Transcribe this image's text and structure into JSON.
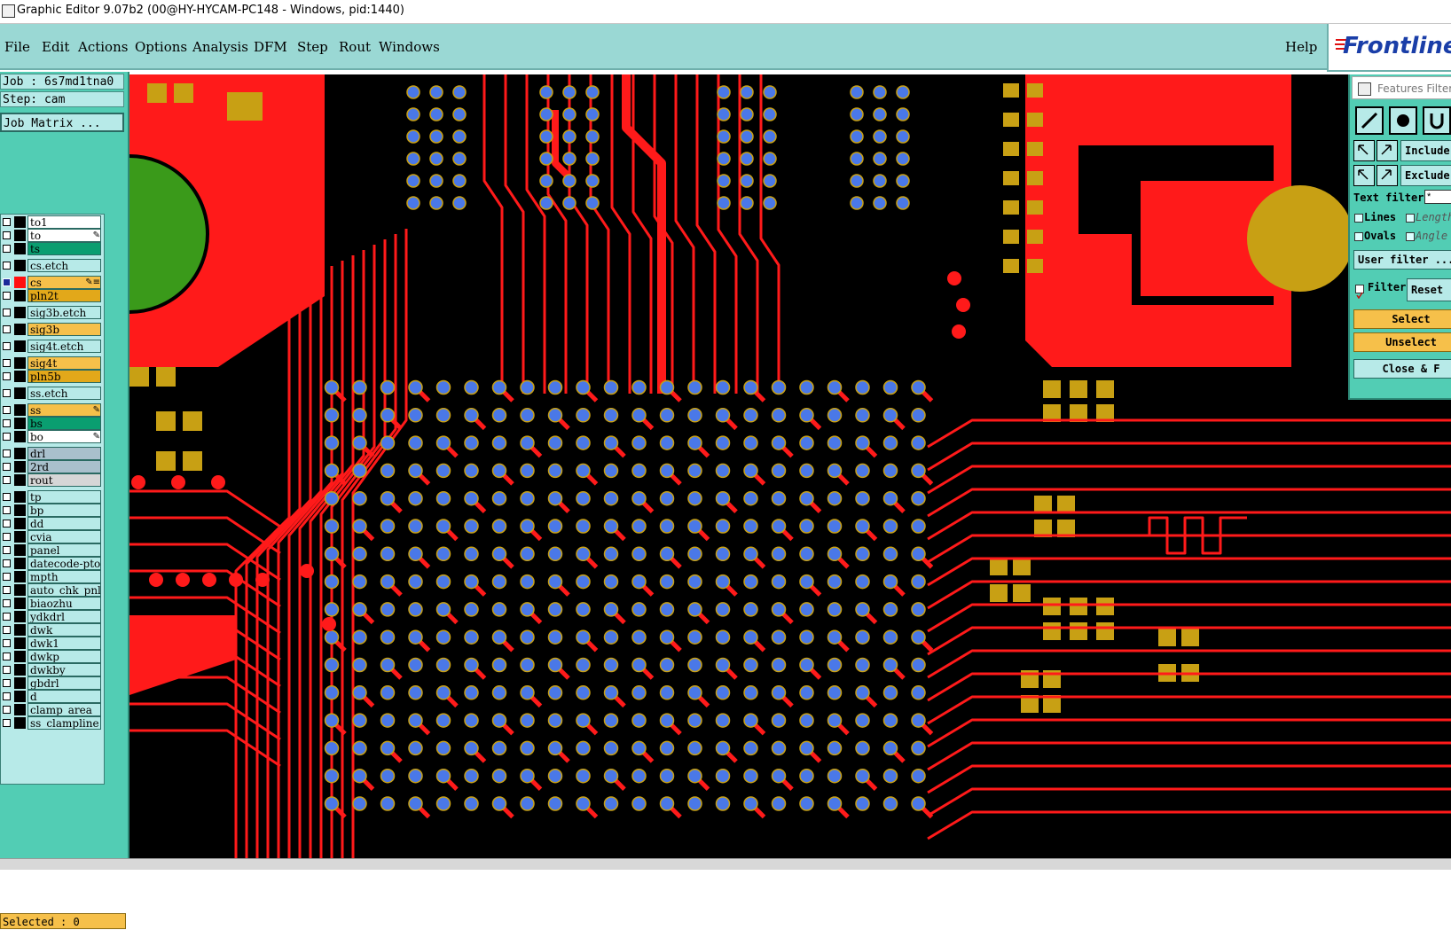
{
  "window": {
    "title": "Graphic Editor 9.07b2 (00@HY-HYCAM-PC148 - Windows, pid:1440)"
  },
  "menubar": {
    "items": [
      "File",
      "Edit",
      "Actions",
      "Options",
      "Analysis",
      "DFM",
      "Step",
      "Rout",
      "Windows"
    ],
    "help": "Help"
  },
  "logo": {
    "text": "Frontline"
  },
  "job": {
    "job_label": "Job : 6s7md1tna0",
    "step_label": "Step: cam",
    "matrix_button": "Job Matrix ..."
  },
  "layers": [
    {
      "name": "to1",
      "color": "#ffffff",
      "swatch": "#000000",
      "mark": ""
    },
    {
      "name": "to",
      "color": "#ffffff",
      "swatch": "#000000",
      "mark": "✎"
    },
    {
      "name": "ts",
      "color": "#0a9e70",
      "swatch": "#000000",
      "mark": ""
    },
    {
      "name": "cs.etch",
      "color": "#b7eae8",
      "swatch": "#000000",
      "mark": ""
    },
    {
      "name": "cs",
      "color": "#f6c04a",
      "swatch": "#ff1010",
      "mark": "✎≡",
      "active": true
    },
    {
      "name": "pln2t",
      "color": "#e2a81a",
      "swatch": "#000000",
      "mark": ""
    },
    {
      "name": "sig3b.etch",
      "color": "#b7eae8",
      "swatch": "#000000",
      "mark": ""
    },
    {
      "name": "sig3b",
      "color": "#f6c04a",
      "swatch": "#000000",
      "mark": ""
    },
    {
      "name": "sig4t.etch",
      "color": "#b7eae8",
      "swatch": "#000000",
      "mark": ""
    },
    {
      "name": "sig4t",
      "color": "#f6c04a",
      "swatch": "#000000",
      "mark": ""
    },
    {
      "name": "pln5b",
      "color": "#e2a81a",
      "swatch": "#000000",
      "mark": ""
    },
    {
      "name": "ss.etch",
      "color": "#b7eae8",
      "swatch": "#000000",
      "mark": ""
    },
    {
      "name": "ss",
      "color": "#f6c04a",
      "swatch": "#000000",
      "mark": "✎"
    },
    {
      "name": "bs",
      "color": "#0a9e70",
      "swatch": "#000000",
      "mark": ""
    },
    {
      "name": "bo",
      "color": "#ffffff",
      "swatch": "#000000",
      "mark": "✎"
    },
    {
      "name": "drl",
      "color": "#a9c0cc",
      "swatch": "#000000",
      "mark": ""
    },
    {
      "name": "2rd",
      "color": "#a9c0cc",
      "swatch": "#000000",
      "mark": ""
    },
    {
      "name": "rout",
      "color": "#d6d6d6",
      "swatch": "#000000",
      "mark": ""
    },
    {
      "name": "tp",
      "color": "#b7eae8",
      "swatch": "#000000",
      "mark": ""
    },
    {
      "name": "bp",
      "color": "#b7eae8",
      "swatch": "#000000",
      "mark": ""
    },
    {
      "name": "dd",
      "color": "#b7eae8",
      "swatch": "#000000",
      "mark": ""
    },
    {
      "name": "cvia",
      "color": "#b7eae8",
      "swatch": "#000000",
      "mark": ""
    },
    {
      "name": "panel",
      "color": "#b7eae8",
      "swatch": "#000000",
      "mark": ""
    },
    {
      "name": "datecode-pto",
      "color": "#b7eae8",
      "swatch": "#000000",
      "mark": ""
    },
    {
      "name": "mpth",
      "color": "#b7eae8",
      "swatch": "#000000",
      "mark": ""
    },
    {
      "name": "auto_chk_pnl",
      "color": "#b7eae8",
      "swatch": "#000000",
      "mark": ""
    },
    {
      "name": "biaozhu",
      "color": "#b7eae8",
      "swatch": "#000000",
      "mark": ""
    },
    {
      "name": "ydkdrl",
      "color": "#b7eae8",
      "swatch": "#000000",
      "mark": ""
    },
    {
      "name": "dwk",
      "color": "#b7eae8",
      "swatch": "#000000",
      "mark": ""
    },
    {
      "name": "dwk1",
      "color": "#b7eae8",
      "swatch": "#000000",
      "mark": ""
    },
    {
      "name": "dwkp",
      "color": "#b7eae8",
      "swatch": "#000000",
      "mark": ""
    },
    {
      "name": "dwkby",
      "color": "#b7eae8",
      "swatch": "#000000",
      "mark": ""
    },
    {
      "name": "gbdrl",
      "color": "#b7eae8",
      "swatch": "#000000",
      "mark": ""
    },
    {
      "name": "d",
      "color": "#b7eae8",
      "swatch": "#000000",
      "mark": ""
    },
    {
      "name": "clamp_area",
      "color": "#b7eae8",
      "swatch": "#000000",
      "mark": ""
    },
    {
      "name": "ss_clampline",
      "color": "#b7eae8",
      "swatch": "#000000",
      "mark": ""
    }
  ],
  "status": {
    "selected": "Selected : 0"
  },
  "features_filter": {
    "title": "Features Filter",
    "include": "Include",
    "exclude": "Exclude",
    "text_filter_label": "Text filter",
    "text_filter_value": "*",
    "lines": "Lines",
    "length": "Length",
    "ovals": "Ovals",
    "angle": "Angle",
    "user_filter": "User filter ...",
    "filter": "Filter",
    "reset": "Reset",
    "select": "Select",
    "unselect": "Unselect",
    "close": "Close & F"
  },
  "colors": {
    "copper": "#ff1a1a",
    "pad_gold": "#c8a014",
    "via_blue": "#4a78e8",
    "green_pad": "#3a9a1a",
    "background": "#000000"
  }
}
